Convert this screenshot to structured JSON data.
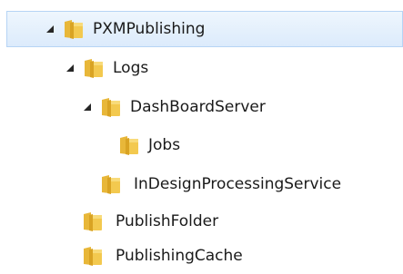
{
  "tree": {
    "colors": {
      "selection_fill": "#dcebfc",
      "selection_border": "#b6d4f5",
      "folder_body": "#f2c54d",
      "folder_front": "#e0a826",
      "expander_arrow": "#262626"
    },
    "items": [
      {
        "label": "PXMPublishing",
        "level": 0,
        "expanded": true,
        "has_children": true,
        "selected": true
      },
      {
        "label": "Logs",
        "level": 1,
        "expanded": true,
        "has_children": true,
        "selected": false
      },
      {
        "label": "DashBoardServer",
        "level": 2,
        "expanded": true,
        "has_children": true,
        "selected": false
      },
      {
        "label": "Jobs",
        "level": 3,
        "expanded": false,
        "has_children": false,
        "selected": false
      },
      {
        "label": "InDesignProcessingService",
        "level": 2,
        "expanded": false,
        "has_children": false,
        "selected": false
      },
      {
        "label": "PublishFolder",
        "level": 1,
        "expanded": false,
        "has_children": false,
        "selected": false
      },
      {
        "label": "PublishingCache",
        "level": 1,
        "expanded": false,
        "has_children": false,
        "selected": false
      }
    ]
  }
}
